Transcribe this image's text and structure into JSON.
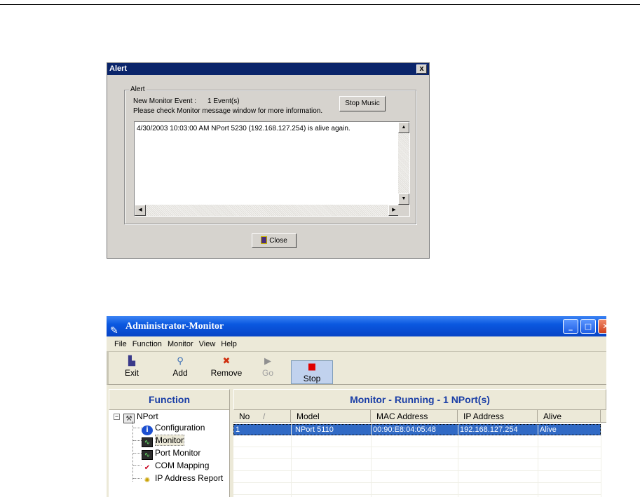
{
  "alert": {
    "title": "Alert",
    "close_glyph": "x",
    "group_label": "Alert",
    "event_label": "New Monitor Event :",
    "event_count": "1 Event(s)",
    "info_text": "Please check Monitor message window for more information.",
    "stop_music_label": "Stop Music",
    "message": "4/30/2003 10:03:00 AM NPort 5230 (192.168.127.254) is alive again.",
    "close_label": "Close"
  },
  "admin": {
    "title": "Administrator-Monitor",
    "menu": [
      "File",
      "Function",
      "Monitor",
      "View",
      "Help"
    ],
    "toolbar": {
      "exit": "Exit",
      "add": "Add",
      "remove": "Remove",
      "go": "Go",
      "stop": "Stop"
    },
    "function_header": "Function",
    "tree": {
      "root": "NPort",
      "items": [
        "Configuration",
        "Monitor",
        "Port Monitor",
        "COM Mapping",
        "IP Address Report"
      ],
      "selected": "Monitor"
    },
    "monitor_header": "Monitor - Running - 1 NPort(s)",
    "columns": [
      "No",
      "Model",
      "MAC Address",
      "IP Address",
      "Alive"
    ],
    "sort_indicator": "/",
    "rows": [
      [
        "1",
        "NPort 5110",
        "00:90:E8:04:05:48",
        "192.168.127.254",
        "Alive"
      ]
    ]
  }
}
